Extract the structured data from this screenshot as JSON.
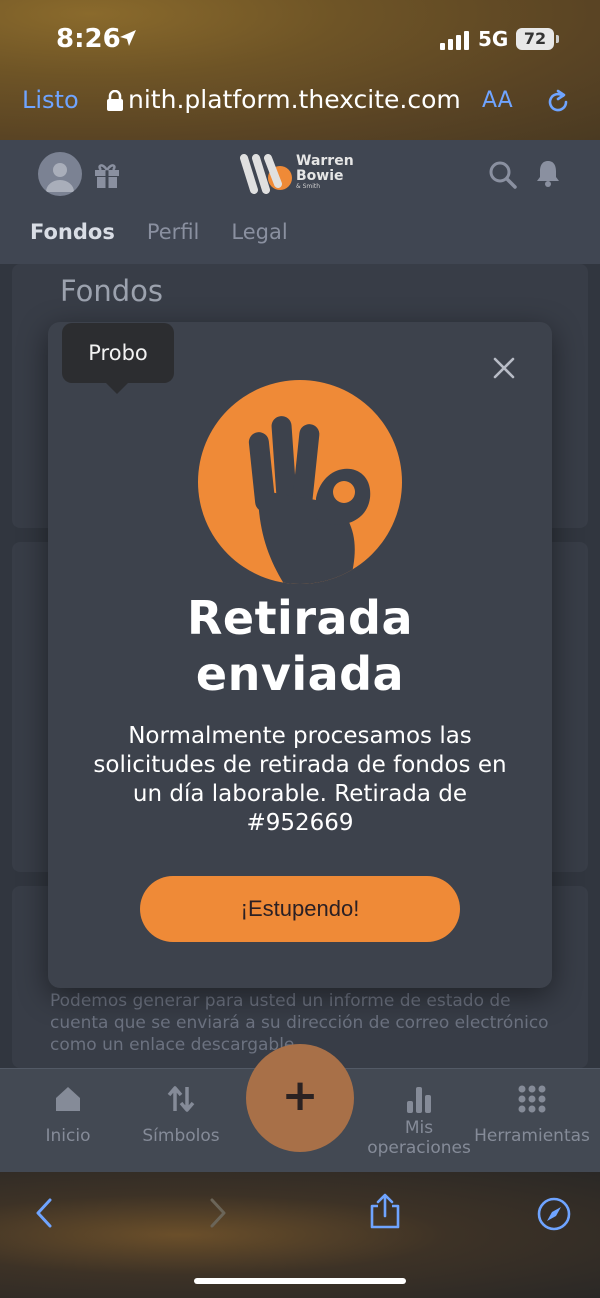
{
  "status_bar": {
    "time": "8:26",
    "network": "5G",
    "battery": "72"
  },
  "browser": {
    "done_label": "Listo",
    "url": "nith.platform.thexcite.com",
    "text_size_label": "AA"
  },
  "header": {
    "logo_line1": "Warren",
    "logo_line2": "Bowie",
    "logo_line3": "& Smith",
    "tabs": [
      {
        "label": "Fondos"
      },
      {
        "label": "Perfil"
      },
      {
        "label": "Legal"
      }
    ]
  },
  "page": {
    "title": "Fondos",
    "background_text": "Podemos generar para usted un informe de estado de cuenta que se enviará a su dirección de correo electrónico como un enlace descargable."
  },
  "tooltip": {
    "text": "Probo"
  },
  "modal": {
    "title_line1": "Retirada",
    "title_line2": "enviada",
    "body": "Normalmente procesamos las solicitudes de retirada de fondos en un día laborable. Retirada de #952669",
    "cta_label": "¡Estupendo!",
    "hero_color": "#ef8a37"
  },
  "bottom_nav": {
    "items": [
      {
        "label": "Inicio",
        "icon": "home-icon"
      },
      {
        "label": "Símbolos",
        "icon": "swap-icon"
      },
      {
        "label": "Mis operaciones",
        "icon": "bar-chart-icon"
      },
      {
        "label": "Herramientas",
        "icon": "grid-icon"
      }
    ],
    "fab_label": "+"
  },
  "colors": {
    "accent": "#ef8a37",
    "link": "#6fa4ff",
    "header_bg": "#404652",
    "modal_bg": "#3d424c"
  }
}
